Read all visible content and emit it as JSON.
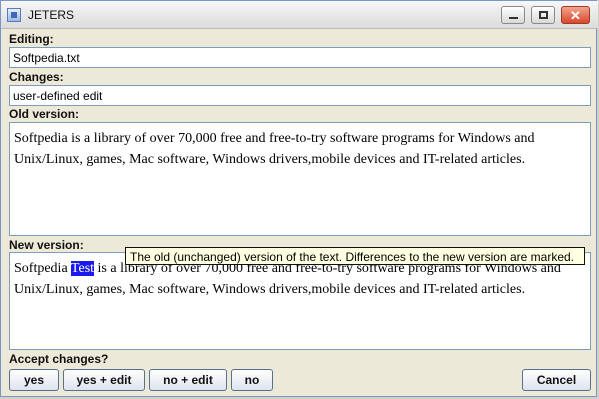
{
  "window": {
    "title": "JETERS"
  },
  "editing": {
    "label": "Editing:",
    "value": "Softpedia.txt"
  },
  "changes": {
    "label": "Changes:",
    "value": "user-defined edit"
  },
  "old_version": {
    "label": "Old version:",
    "lines": [
      "Softpedia is a library of over 70,000 free and free-to-try software programs for Windows and",
      "Unix/Linux, games, Mac software, Windows drivers,mobile devices and IT-related articles."
    ]
  },
  "new_version": {
    "label": "New version:",
    "line1_before": "Softpedia ",
    "line1_highlight": "Test",
    "line1_after": " is a library of over 70,000 free and free-to-try software programs for Windows and",
    "line2": "Unix/Linux, games, Mac software, Windows drivers,mobile devices and IT-related articles."
  },
  "tooltip": {
    "text": "The old (unchanged) version of the text. Differences to the new version are marked."
  },
  "accept": {
    "label": "Accept changes?",
    "buttons": {
      "yes": "yes",
      "yes_edit": "yes + edit",
      "no_edit": "no + edit",
      "no": "no",
      "cancel": "Cancel"
    }
  },
  "colors": {
    "highlight": "#1a1aee",
    "tooltip_bg": "#ffffe1"
  }
}
